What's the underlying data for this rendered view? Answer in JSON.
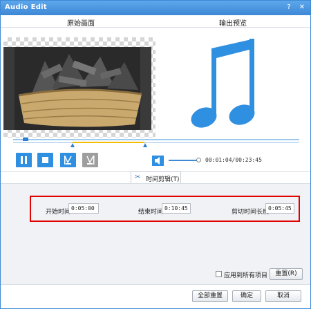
{
  "window": {
    "title": "Audio Edit",
    "help_glyph": "?",
    "close_glyph": "✕"
  },
  "panes": {
    "original_title": "原始画面",
    "preview_title": "输出预览"
  },
  "playback": {
    "current_time": "00:01:04",
    "total_time": "00:23:45",
    "time_display": "00:01:04/00:23:45"
  },
  "tab": {
    "label": "时间剪辑(T)",
    "icon": "scissors-icon"
  },
  "trim": {
    "start_label": "开始时间",
    "start_value": "0:05:00",
    "end_label": "结束时间",
    "end_value": "0:10:45",
    "duration_label": "剪切时间长度",
    "duration_value": "0:05:45"
  },
  "options": {
    "apply_all_label": "应用到所有项目",
    "apply_all_checked": false,
    "reset_label": "重置(R)"
  },
  "footer": {
    "reset_all_label": "全部重置",
    "ok_label": "确定",
    "cancel_label": "取消"
  },
  "colors": {
    "accent": "#2f8fe0",
    "title_bar": "#3d88d6",
    "trim_range": "#f0c000",
    "highlight": "#e00000",
    "note": "#2f8fe0"
  },
  "icons": [
    "help-icon",
    "close-icon",
    "pause-icon",
    "stop-icon",
    "trim-start-icon",
    "trim-end-icon",
    "volume-icon",
    "scissors-icon",
    "music-note-icon"
  ]
}
